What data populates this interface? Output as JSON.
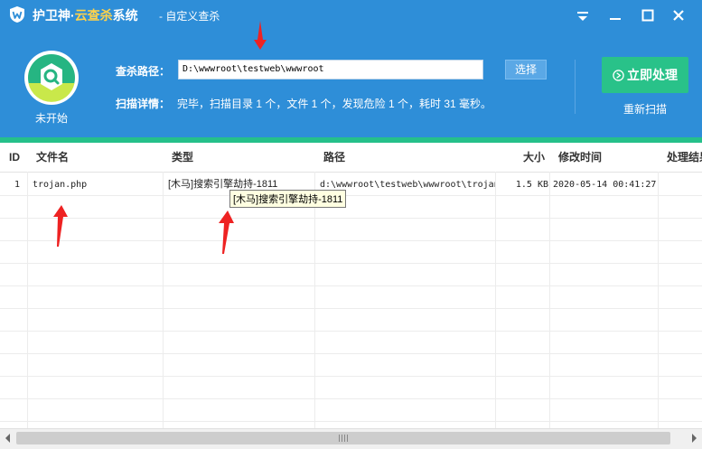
{
  "app": {
    "name_part1": "护卫神·",
    "name_part2": "云查杀",
    "name_part3": "系统",
    "subtitle": "- 自定义查杀"
  },
  "status": {
    "text": "未开始"
  },
  "scan": {
    "path_label": "查杀路径：",
    "path_value": "D:\\wwwroot\\testweb\\wwwroot",
    "select_label": "选择",
    "detail_label": "扫描详情：",
    "detail_text": "完毕，扫描目录 1 个，文件 1 个，发现危险 1 个，耗时 31 毫秒。"
  },
  "actions": {
    "process_label": "立即处理",
    "rescan_label": "重新扫描"
  },
  "table": {
    "headers": {
      "id": "ID",
      "filename": "文件名",
      "type": "类型",
      "path": "路径",
      "size": "大小",
      "mtime": "修改时间",
      "result": "处理结果"
    },
    "rows": [
      {
        "id": "1",
        "filename": "trojan.php",
        "type": "[木马]搜索引擎劫持-1811",
        "path": "d:\\wwwroot\\testweb\\wwwroot\\trojan.php",
        "size": "1.5 KB",
        "mtime": "2020-05-14 00:41:27",
        "result": ""
      }
    ]
  },
  "tooltip": {
    "text": "[木马]搜索引擎劫持-1811"
  },
  "colors": {
    "header_bg": "#2e8ed8",
    "accent_green": "#29c289",
    "title_accent": "#ffd24a",
    "arrow_red": "#ee2222"
  },
  "icons": {
    "logo": "shield-w-icon",
    "status": "magnifier-shield-icon",
    "menu": "dropdown-menu-icon",
    "minimize": "minimize-icon",
    "maximize": "maximize-icon",
    "close": "close-icon",
    "process": "arrow-circle-icon"
  }
}
